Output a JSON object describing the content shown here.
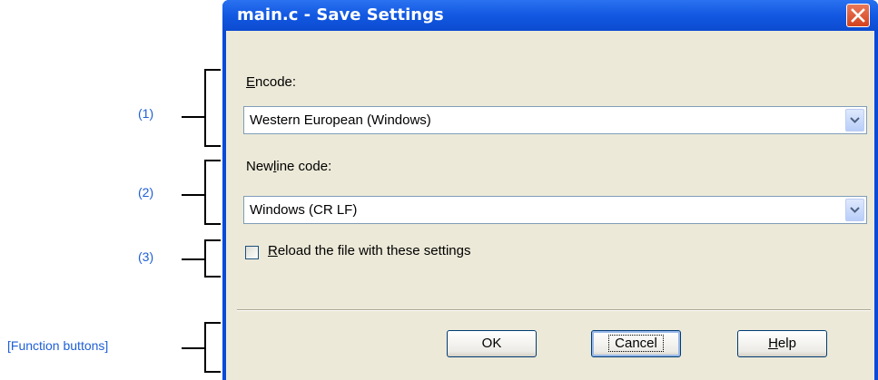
{
  "callouts": {
    "c1": "(1)",
    "c2": "(2)",
    "c3": "(3)",
    "c4": "[Function buttons]"
  },
  "dialog": {
    "title": "main.c - Save Settings",
    "encode": {
      "label_mnemonic": "E",
      "label_rest": "ncode:",
      "value": "Western European (Windows)"
    },
    "newline": {
      "label_pre": "New",
      "label_mnemonic": "l",
      "label_rest": "ine code:",
      "value": "Windows (CR LF)"
    },
    "reload": {
      "checked": false,
      "label_mnemonic": "R",
      "label_rest": "eload the file with these settings"
    },
    "buttons": {
      "ok": "OK",
      "cancel": "Cancel",
      "help_mnemonic": "H",
      "help_rest": "elp"
    }
  },
  "icons": {
    "close": "close-icon",
    "dropdown": "chevron-down-icon"
  },
  "colors": {
    "callout_text": "#1f5fd6",
    "titlebar": "#0a4ad8",
    "client_bg": "#ece9d8",
    "close_btn": "#d4421d"
  }
}
